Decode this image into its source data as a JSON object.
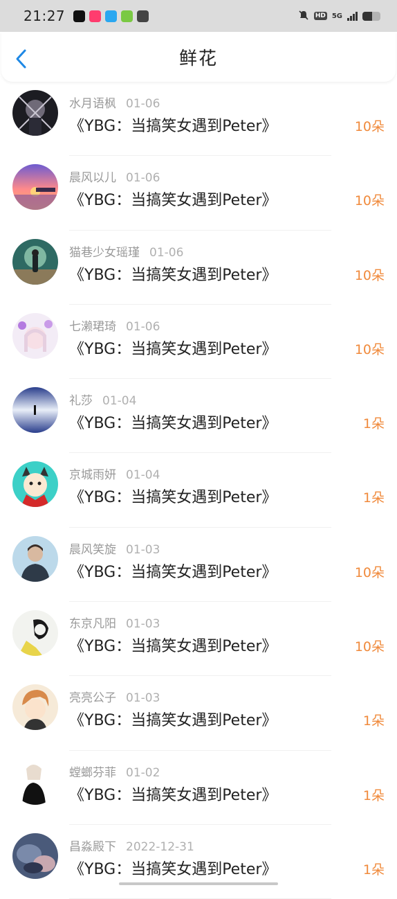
{
  "status_bar": {
    "time": "21:27",
    "network": "5G",
    "hd": "HD",
    "app_icons": [
      "tiktok-icon",
      "shopping-app-icon",
      "qq-browser-icon",
      "round-app-icon",
      "mail-icon"
    ],
    "app_icon_colors": [
      "#111111",
      "#ff3c6e",
      "#2aa7f0",
      "#7ac943",
      "#444444"
    ],
    "battery_level": 0.55
  },
  "header": {
    "title": "鲜花"
  },
  "colors": {
    "accent": "#1e88e5",
    "amount": "#f08a3c"
  },
  "list": [
    {
      "name": "水月语枫",
      "date": "01-06",
      "title": "《YBG：当搞笑女遇到Peter》",
      "amount": "10朵",
      "avatar": "dark-abstract-avatar"
    },
    {
      "name": "晨风以儿",
      "date": "01-06",
      "title": "《YBG：当搞笑女遇到Peter》",
      "amount": "10朵",
      "avatar": "sunset-sea-avatar"
    },
    {
      "name": "猫巷少女瑶瑾",
      "date": "01-06",
      "title": "《YBG：当搞笑女遇到Peter》",
      "amount": "10朵",
      "avatar": "girl-in-landscape-avatar"
    },
    {
      "name": "七濑珺琦",
      "date": "01-06",
      "title": "《YBG：当搞笑女遇到Peter》",
      "amount": "10朵",
      "avatar": "anime-girl-purple-avatar"
    },
    {
      "name": "礼莎",
      "date": "01-04",
      "title": "《YBG：当搞笑女遇到Peter》",
      "amount": "1朵",
      "avatar": "reflection-lake-avatar"
    },
    {
      "name": "京城雨妍",
      "date": "01-04",
      "title": "《YBG：当搞笑女遇到Peter》",
      "amount": "1朵",
      "avatar": "cartoon-devil-avatar"
    },
    {
      "name": "晨风笑旋",
      "date": "01-03",
      "title": "《YBG：当搞笑女遇到Peter》",
      "amount": "10朵",
      "avatar": "man-portrait-avatar"
    },
    {
      "name": "东京凡阳",
      "date": "01-03",
      "title": "《YBG：当搞笑女遇到Peter》",
      "amount": "10朵",
      "avatar": "sketch-yellow-avatar"
    },
    {
      "name": "亮亮公子",
      "date": "01-03",
      "title": "《YBG：当搞笑女遇到Peter》",
      "amount": "1朵",
      "avatar": "anime-boy-avatar"
    },
    {
      "name": "螳螂芬菲",
      "date": "01-02",
      "title": "《YBG：当搞笑女遇到Peter》",
      "amount": "1朵",
      "avatar": "anime-figure-white-avatar"
    },
    {
      "name": "昌淼殿下",
      "date": "2022-12-31",
      "title": "《YBG：当搞笑女遇到Peter》",
      "amount": "1朵",
      "avatar": "blurred-photo-avatar"
    }
  ]
}
